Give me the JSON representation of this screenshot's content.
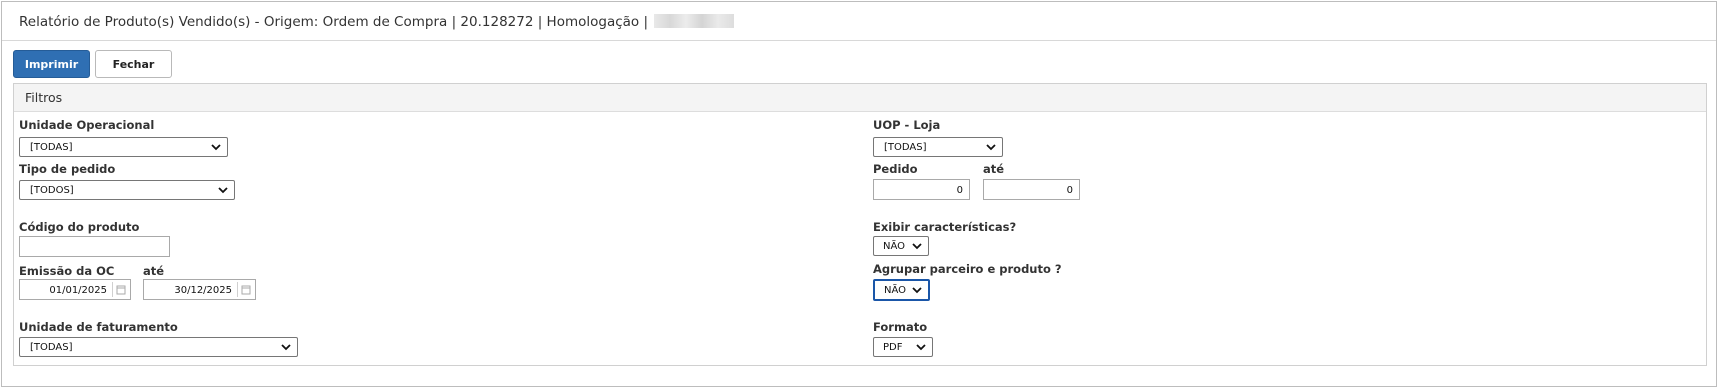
{
  "header": {
    "title": "Relatório de Produto(s) Vendido(s) - Origem: Ordem de Compra | 20.128272 | Homologação |"
  },
  "toolbar": {
    "print_label": "Imprimir",
    "close_label": "Fechar"
  },
  "filters": {
    "title": "Filtros",
    "unidade_operacional": {
      "label": "Unidade Operacional",
      "value": "[TODAS]"
    },
    "tipo_pedido": {
      "label": "Tipo de pedido",
      "value": "[TODOS]"
    },
    "codigo_produto": {
      "label": "Código do produto",
      "value": ""
    },
    "emissao_oc": {
      "label": "Emissão da OC",
      "ate": "até",
      "from": "01/01/2025",
      "to": "30/12/2025"
    },
    "unidade_faturamento": {
      "label": "Unidade de faturamento",
      "value": "[TODAS]"
    },
    "uop_loja": {
      "label": "UOP - Loja",
      "value": "[TODAS]"
    },
    "pedido": {
      "label": "Pedido",
      "ate": "até",
      "from": "0",
      "to": "0"
    },
    "exibir_caracteristicas": {
      "label": "Exibir características?",
      "value": "NÃO"
    },
    "agrupar": {
      "label": "Agrupar parceiro e produto ?",
      "value": "NÃO"
    },
    "formato": {
      "label": "Formato",
      "value": "PDF"
    }
  },
  "icons": {
    "dropdown": "chevron-down-icon",
    "calendar": "calendar-icon"
  }
}
